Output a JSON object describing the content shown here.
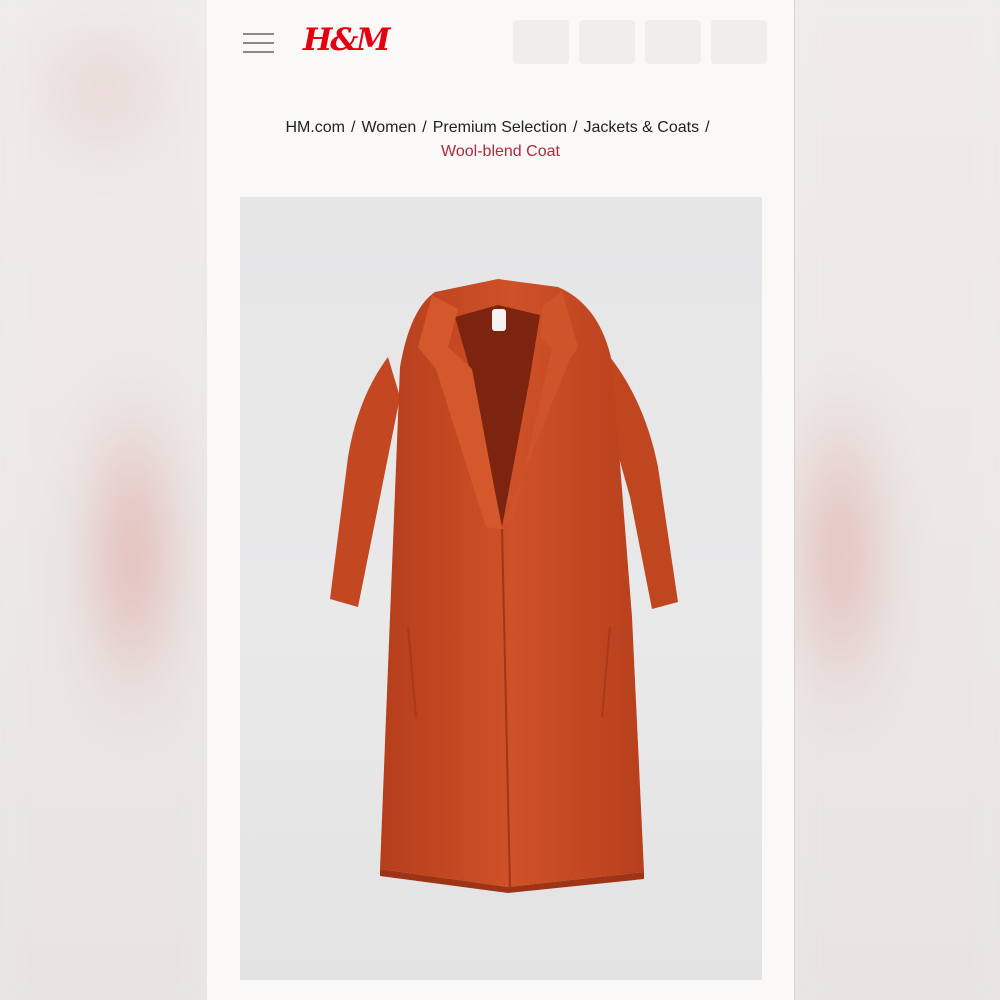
{
  "header": {
    "logo_text": "H&M",
    "menu_icon": "hamburger-menu-icon",
    "brand_color": "#e50010"
  },
  "breadcrumb": {
    "items": [
      "HM.com",
      "Women",
      "Premium Selection",
      "Jackets & Coats"
    ],
    "separator": "/",
    "current": "Wool-blend Coat",
    "current_color": "#b0293a"
  },
  "product": {
    "image_description_icon": "coat-image",
    "coat_color": "#c84a24"
  }
}
